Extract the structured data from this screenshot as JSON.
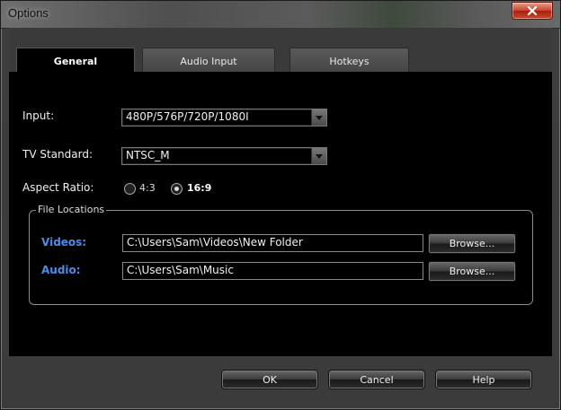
{
  "window": {
    "title": "Options"
  },
  "tabs": [
    {
      "label": "General"
    },
    {
      "label": "Audio Input"
    },
    {
      "label": "Hotkeys"
    }
  ],
  "general": {
    "input_label": "Input:",
    "input_value": "480P/576P/720P/1080I",
    "tv_standard_label": "TV Standard:",
    "tv_standard_value": "NTSC_M",
    "aspect_ratio_label": "Aspect Ratio:",
    "aspect_options": [
      {
        "label": "4:3",
        "selected": false
      },
      {
        "label": "16:9",
        "selected": true
      }
    ],
    "file_locations": {
      "title": "File Locations",
      "videos_label": "Videos:",
      "videos_path": "C:\\Users\\Sam\\Videos\\New Folder",
      "audio_label": "Audio:",
      "audio_path": "C:\\Users\\Sam\\Music",
      "browse_label": "Browse..."
    }
  },
  "footer": {
    "ok_label": "OK",
    "cancel_label": "Cancel",
    "help_label": "Help"
  },
  "colors": {
    "accent_label": "#4a8ee8",
    "panel_bg": "#000000",
    "close_button": "#c8402c"
  }
}
